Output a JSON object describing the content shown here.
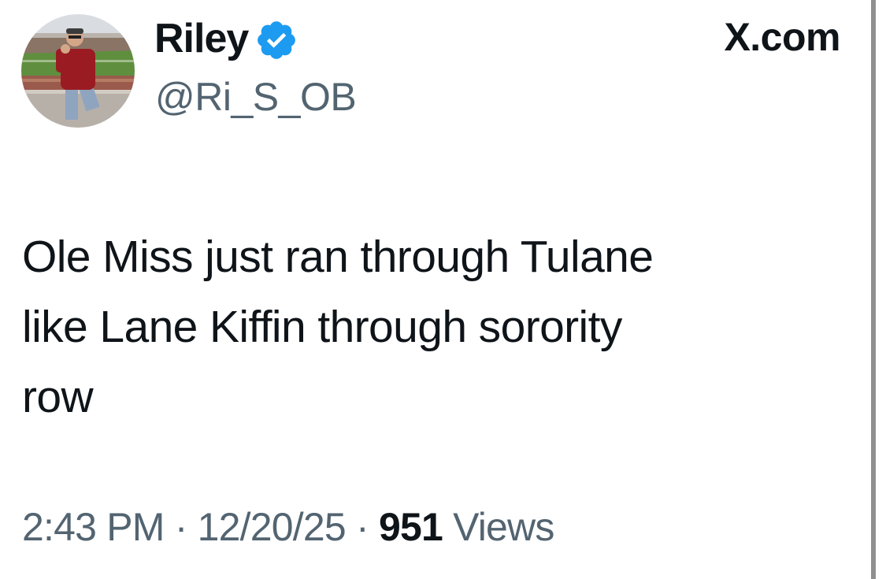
{
  "author": {
    "display_name": "Riley",
    "handle": "@Ri_S_OB",
    "verified": true,
    "verified_color": "#1d9bf0"
  },
  "site_label": "X.com",
  "tweet": {
    "text": "Ole Miss just ran through Tulane\nlike Lane Kiffin through sorority\nrow"
  },
  "meta": {
    "time": "2:43 PM",
    "separator": "·",
    "date": "12/20/25",
    "views_count": "951",
    "views_label": "Views"
  },
  "colors": {
    "text_primary": "#0f1419",
    "text_secondary": "#536471",
    "background": "#ffffff"
  },
  "icons": {
    "verified": "verified-badge-icon",
    "avatar": "profile-photo"
  }
}
